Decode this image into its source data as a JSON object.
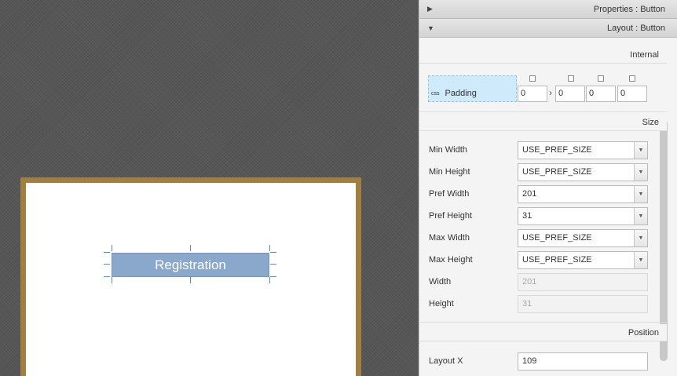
{
  "canvas": {
    "button_label": "Registration"
  },
  "panel": {
    "properties": {
      "arrow": "▶",
      "title": "Properties",
      "separator": " : ",
      "type": "Button"
    },
    "layout": {
      "arrow": "▼",
      "title": "Layout",
      "separator": " : ",
      "type": "Button"
    },
    "internal_header": "Internal",
    "padding": {
      "css_tag": "css",
      "label": "Padding",
      "values": [
        "0",
        "0",
        "0",
        "0"
      ],
      "separator": "›"
    },
    "size_header": "Size",
    "size_rows": [
      {
        "label": "Min Width",
        "value": "USE_PREF_SIZE",
        "kind": "combo"
      },
      {
        "label": "Min Height",
        "value": "USE_PREF_SIZE",
        "kind": "combo"
      },
      {
        "label": "Pref Width",
        "value": "201",
        "kind": "combo"
      },
      {
        "label": "Pref Height",
        "value": "31",
        "kind": "combo"
      },
      {
        "label": "Max Width",
        "value": "USE_PREF_SIZE",
        "kind": "combo"
      },
      {
        "label": "Max Height",
        "value": "USE_PREF_SIZE",
        "kind": "combo"
      },
      {
        "label": "Width",
        "value": "201",
        "kind": "readonly"
      },
      {
        "label": "Height",
        "value": "31",
        "kind": "readonly"
      }
    ],
    "position_header": "Position",
    "position_rows": [
      {
        "label": "Layout X",
        "value": "109"
      }
    ]
  },
  "colors": {
    "workspace_bg": "#565656",
    "scene_border": "#a27f40",
    "button_fill": "#8aa8cb",
    "selection_handle": "#4a90d0",
    "padding_highlight": "#cfeafb"
  }
}
